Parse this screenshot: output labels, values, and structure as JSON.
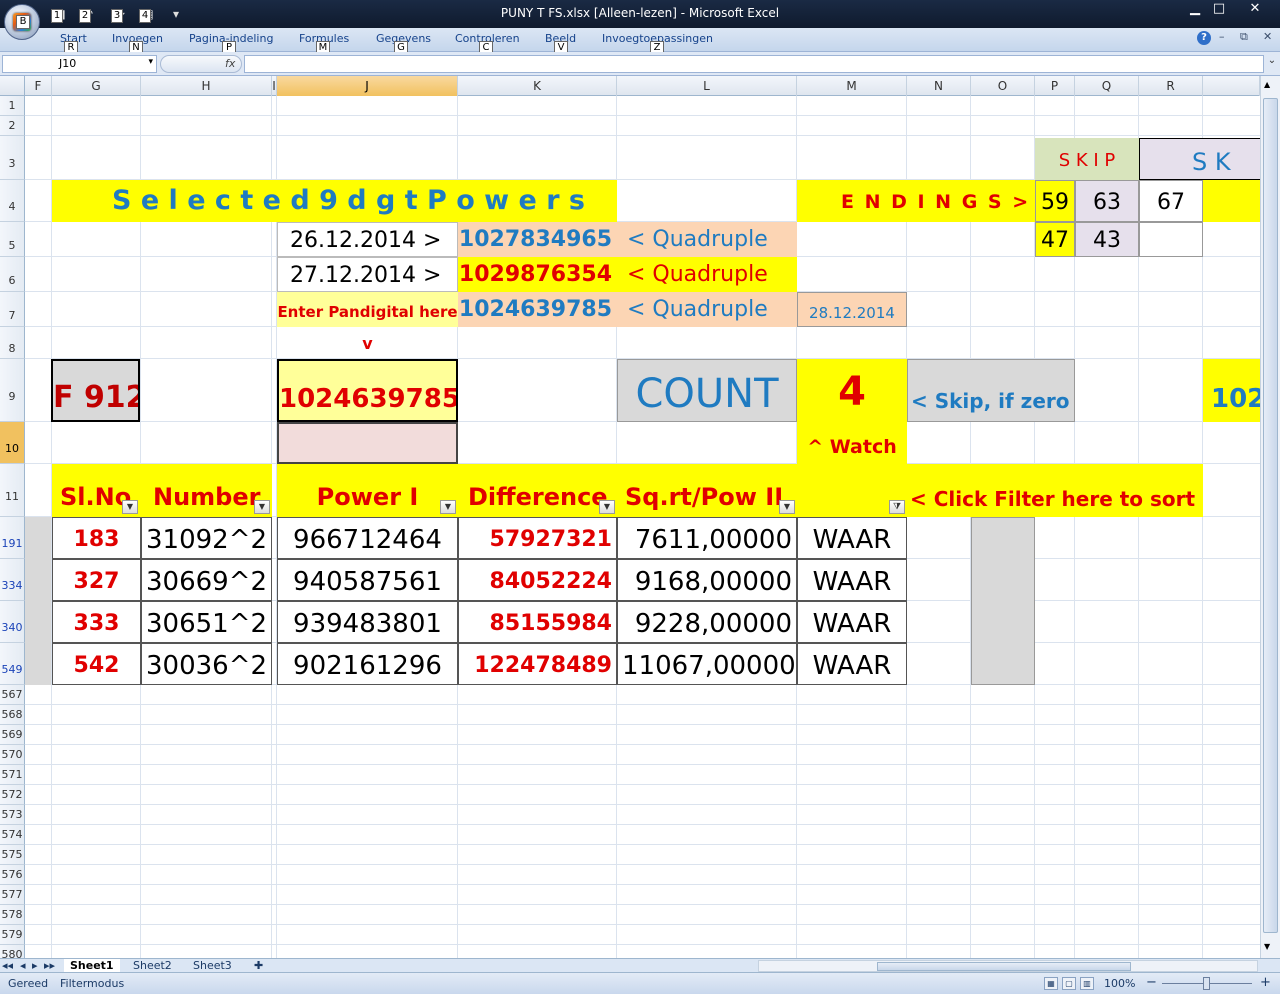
{
  "window": {
    "title": "PUNY T FS.xlsx  [Alleen-lezen] - Microsoft Excel",
    "minimize": "▁",
    "maximize": "□",
    "close": "✕"
  },
  "office_button": {
    "key": "B"
  },
  "qat": {
    "items": [
      {
        "icon": "save-icon",
        "glyph": "■",
        "key": "1"
      },
      {
        "icon": "undo-icon",
        "glyph": "↶",
        "key": "2"
      },
      {
        "icon": "redo-icon",
        "glyph": "↷",
        "key": "3"
      },
      {
        "icon": "print-icon",
        "glyph": "▤",
        "key": "4"
      },
      {
        "icon": "customize-icon",
        "glyph": "▾",
        "key": ""
      }
    ]
  },
  "ribbon": {
    "tabs": [
      {
        "label": "Start",
        "key": "R"
      },
      {
        "label": "Invoegen",
        "key": "N"
      },
      {
        "label": "Pagina-indeling",
        "key": "P"
      },
      {
        "label": "Formules",
        "key": "M"
      },
      {
        "label": "Gegevens",
        "key": "G"
      },
      {
        "label": "Controleren",
        "key": "C"
      },
      {
        "label": "Beeld",
        "key": "V"
      },
      {
        "label": "Invoegtoepassingen",
        "key": "Z"
      }
    ],
    "help": "?",
    "min": "–",
    "restore": "⧉",
    "close": "✕"
  },
  "formula_bar": {
    "name_box": "J10",
    "fx": "fx",
    "dropdown": "▾",
    "content": "",
    "expand": "⌄"
  },
  "columns": [
    {
      "label": "F"
    },
    {
      "label": "G"
    },
    {
      "label": "H"
    },
    {
      "label": "I"
    },
    {
      "label": "J"
    },
    {
      "label": "K"
    },
    {
      "label": "L"
    },
    {
      "label": "M"
    },
    {
      "label": "N"
    },
    {
      "label": "O"
    },
    {
      "label": "P"
    },
    {
      "label": "Q"
    },
    {
      "label": "R"
    },
    {
      "label": ""
    }
  ],
  "rows": [
    "1",
    "2",
    "3",
    "4",
    "5",
    "6",
    "7",
    "8",
    "9",
    "10",
    "11",
    "191",
    "334",
    "340",
    "549",
    "567",
    "568",
    "569",
    "570",
    "571",
    "572",
    "573",
    "574",
    "575",
    "576",
    "577",
    "578",
    "579",
    "580"
  ],
  "cells": {
    "skip_p": "S K I P",
    "skip_r": "S  K",
    "title": "S e l e c t e d   9 d g t   P o w e r s",
    "endings": "E N D I N G S  >",
    "p4": "59",
    "q4": "63",
    "r4": "67",
    "p5": "47",
    "q5": "43",
    "j5": "26.12.2014  >",
    "k5": "1027834965",
    "l5": "<  Quadruple",
    "j6": "27.12.2014  >",
    "k6": "1029876354",
    "l6": "<  Quadruple",
    "j7": "Enter Pandigital here",
    "k7": "1024639785",
    "l7": "<  Quadruple",
    "m7": "28.12.2014",
    "j8": "v",
    "g9": "F 912",
    "j9": "1024639785",
    "l9": "COUNT",
    "m9": "4",
    "n9": "< Skip, if zero",
    "s9": "102",
    "m10": "^  Watch",
    "g11": "Sl.No",
    "h11": "Number",
    "j11": "Power I",
    "k11": "Difference",
    "l11": "Sq.rt/Pow II",
    "n11": "< Click Filter here to sort"
  },
  "table": {
    "rows": [
      {
        "sl": "183",
        "number": "31092^2",
        "power": "966712464",
        "diff": "57927321",
        "sqrt": "7611,00000",
        "flag": "WAAR"
      },
      {
        "sl": "327",
        "number": "30669^2",
        "power": "940587561",
        "diff": "84052224",
        "sqrt": "9168,00000",
        "flag": "WAAR"
      },
      {
        "sl": "333",
        "number": "30651^2",
        "power": "939483801",
        "diff": "85155984",
        "sqrt": "9228,00000",
        "flag": "WAAR"
      },
      {
        "sl": "542",
        "number": "30036^2",
        "power": "902161296",
        "diff": "122478489",
        "sqrt": "11067,00000",
        "flag": "WAAR"
      }
    ]
  },
  "sheet_tabs": {
    "nav": [
      "◂◂",
      "◂",
      "▸",
      "▸▸"
    ],
    "tabs": [
      {
        "label": "Sheet1"
      },
      {
        "label": "Sheet2"
      },
      {
        "label": "Sheet3"
      }
    ],
    "new_sheet": "✚"
  },
  "status": {
    "ready": "Gereed",
    "mode": "Filtermodus",
    "zoom": "100%",
    "zoom_out": "−",
    "zoom_in": "+"
  },
  "colors": {
    "yellow": "#ffff00",
    "red": "#e00000",
    "blue": "#1f7bc1",
    "peach": "#fcd5b4",
    "selection": "#f1c15f"
  }
}
